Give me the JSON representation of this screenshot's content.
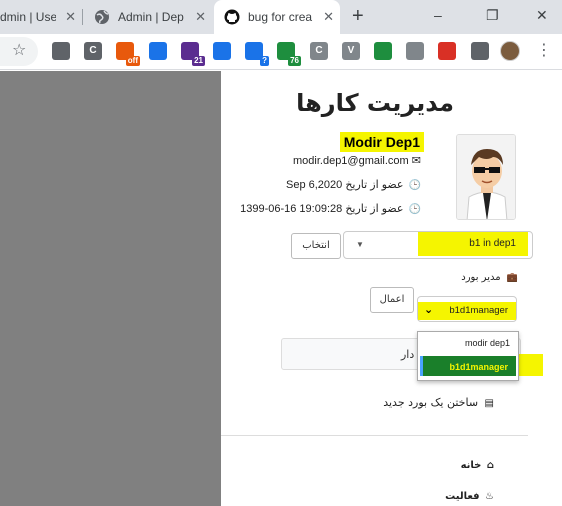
{
  "tabs": [
    {
      "label": "dmin | Use",
      "active": false
    },
    {
      "label": "Admin | Dep",
      "active": false
    },
    {
      "label": "bug for crea",
      "active": true
    }
  ],
  "window_controls": {
    "new_tab": "+",
    "minimize": "–",
    "restore": "❐",
    "close": "✕"
  },
  "toolbar": {
    "extensions": [
      {
        "icon": "cloud-link-icon",
        "color": "#5f6368"
      },
      {
        "icon": "c-lines-icon",
        "color": "#5f6368",
        "text": "C"
      },
      {
        "icon": "coupon-off-icon",
        "color": "#e8590c",
        "badge": "off"
      },
      {
        "icon": "arrow-k-icon",
        "color": "#1a73e8"
      },
      {
        "icon": "graduation-cap-icon",
        "color": "#5b2d90",
        "badge": "21"
      },
      {
        "icon": "cloud-drive-icon",
        "color": "#1a73e8"
      },
      {
        "icon": "chart-question-icon",
        "color": "#1a73e8",
        "badge": "?"
      },
      {
        "icon": "stopwatch-icon",
        "color": "#1e8e3e",
        "badge": "76"
      },
      {
        "icon": "c-square-icon",
        "color": "#80868b",
        "text": "C"
      },
      {
        "icon": "v-icon",
        "color": "#80868b",
        "text": "V"
      },
      {
        "icon": "sheet-icon",
        "color": "#1e8e3e"
      },
      {
        "icon": "x-square-icon",
        "color": "#80868b"
      },
      {
        "icon": "red-arrow-icon",
        "color": "#d93025"
      },
      {
        "icon": "puzzle-icon",
        "color": "#5f6368"
      }
    ]
  },
  "page": {
    "title": "مدیریت کارها",
    "user": {
      "name": "Modir Dep1",
      "email": "modir.dep1@gmail.com",
      "member_since_label": "عضو از تاریخ",
      "member_since_gregorian": "Sep 6,2020",
      "member_since_jalali": "1399-06-16 19:09:28"
    },
    "department": {
      "selected": "b1 in dep1",
      "select_button": "انتخاب"
    },
    "board": {
      "label": "مدیر بورد",
      "apply_button": "اعمال",
      "role_selected": "b1d1manager",
      "role_options": [
        "modir dep1",
        "b1d1manager"
      ]
    },
    "input_partial_text": "دار",
    "new_board_label": "ساختن یک بورد جدید",
    "nav": [
      {
        "label": "خانه",
        "icon": "home-icon"
      },
      {
        "label": "فعالیت",
        "icon": "fire-icon"
      }
    ]
  }
}
